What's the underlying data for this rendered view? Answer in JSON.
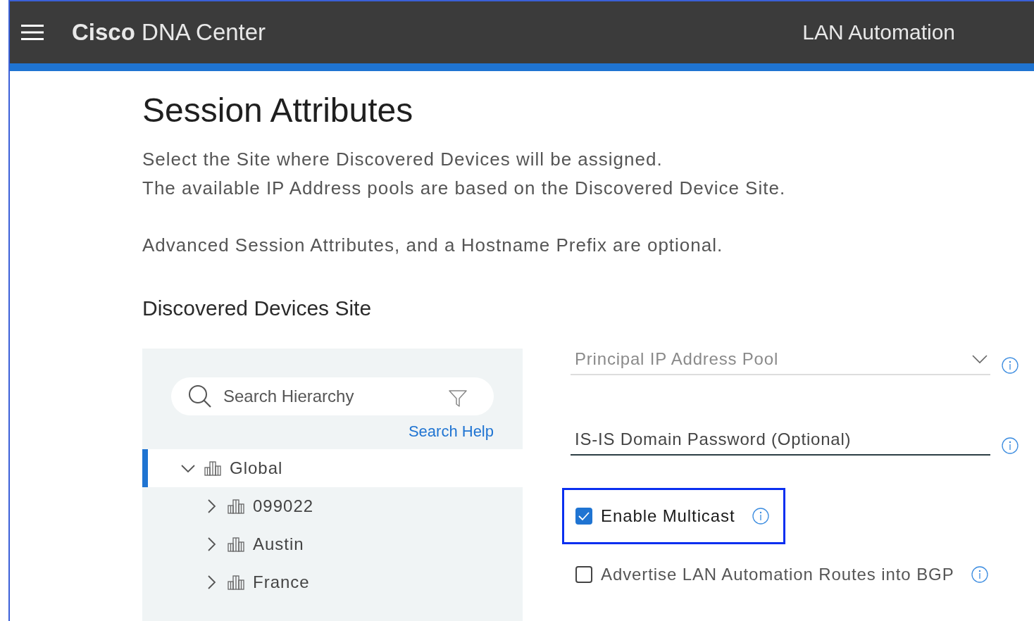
{
  "header": {
    "brand": "**Cisco** DNA Center",
    "page_title": "LAN Automation"
  },
  "title": "Session Attributes",
  "description": [
    "Select the Site where Discovered Devices will be assigned.",
    "The available IP Address pools are based on the Discovered Device Site."
  ],
  "note": "Advanced Session Attributes, and a Hostname Prefix are optional.",
  "section_title": "Discovered Devices Site",
  "site_tree": {
    "search": {
      "placeholder": "Search Hierarchy"
    },
    "help_link": "Search Help",
    "items": [
      {
        "label": "Global",
        "expanded": true,
        "selected": true,
        "children": [
          {
            "label": "099022",
            "expanded": false,
            "selected": false
          },
          {
            "label": "Austin",
            "expanded": false,
            "selected": false
          },
          {
            "label": "France",
            "expanded": false,
            "selected": false
          }
        ]
      }
    ]
  },
  "fields": [
    {
      "kind": "dropdown",
      "placeholder": "Principal IP Address Pool"
    },
    {
      "kind": "text",
      "placeholder": "IS-IS Domain Password (Optional)"
    }
  ],
  "checkboxes": [
    {
      "label": "Enable Multicast",
      "checked": true,
      "highlighted": true
    },
    {
      "label": "Advertise LAN Automation Routes into BGP",
      "checked": false,
      "highlighted": false
    }
  ]
}
